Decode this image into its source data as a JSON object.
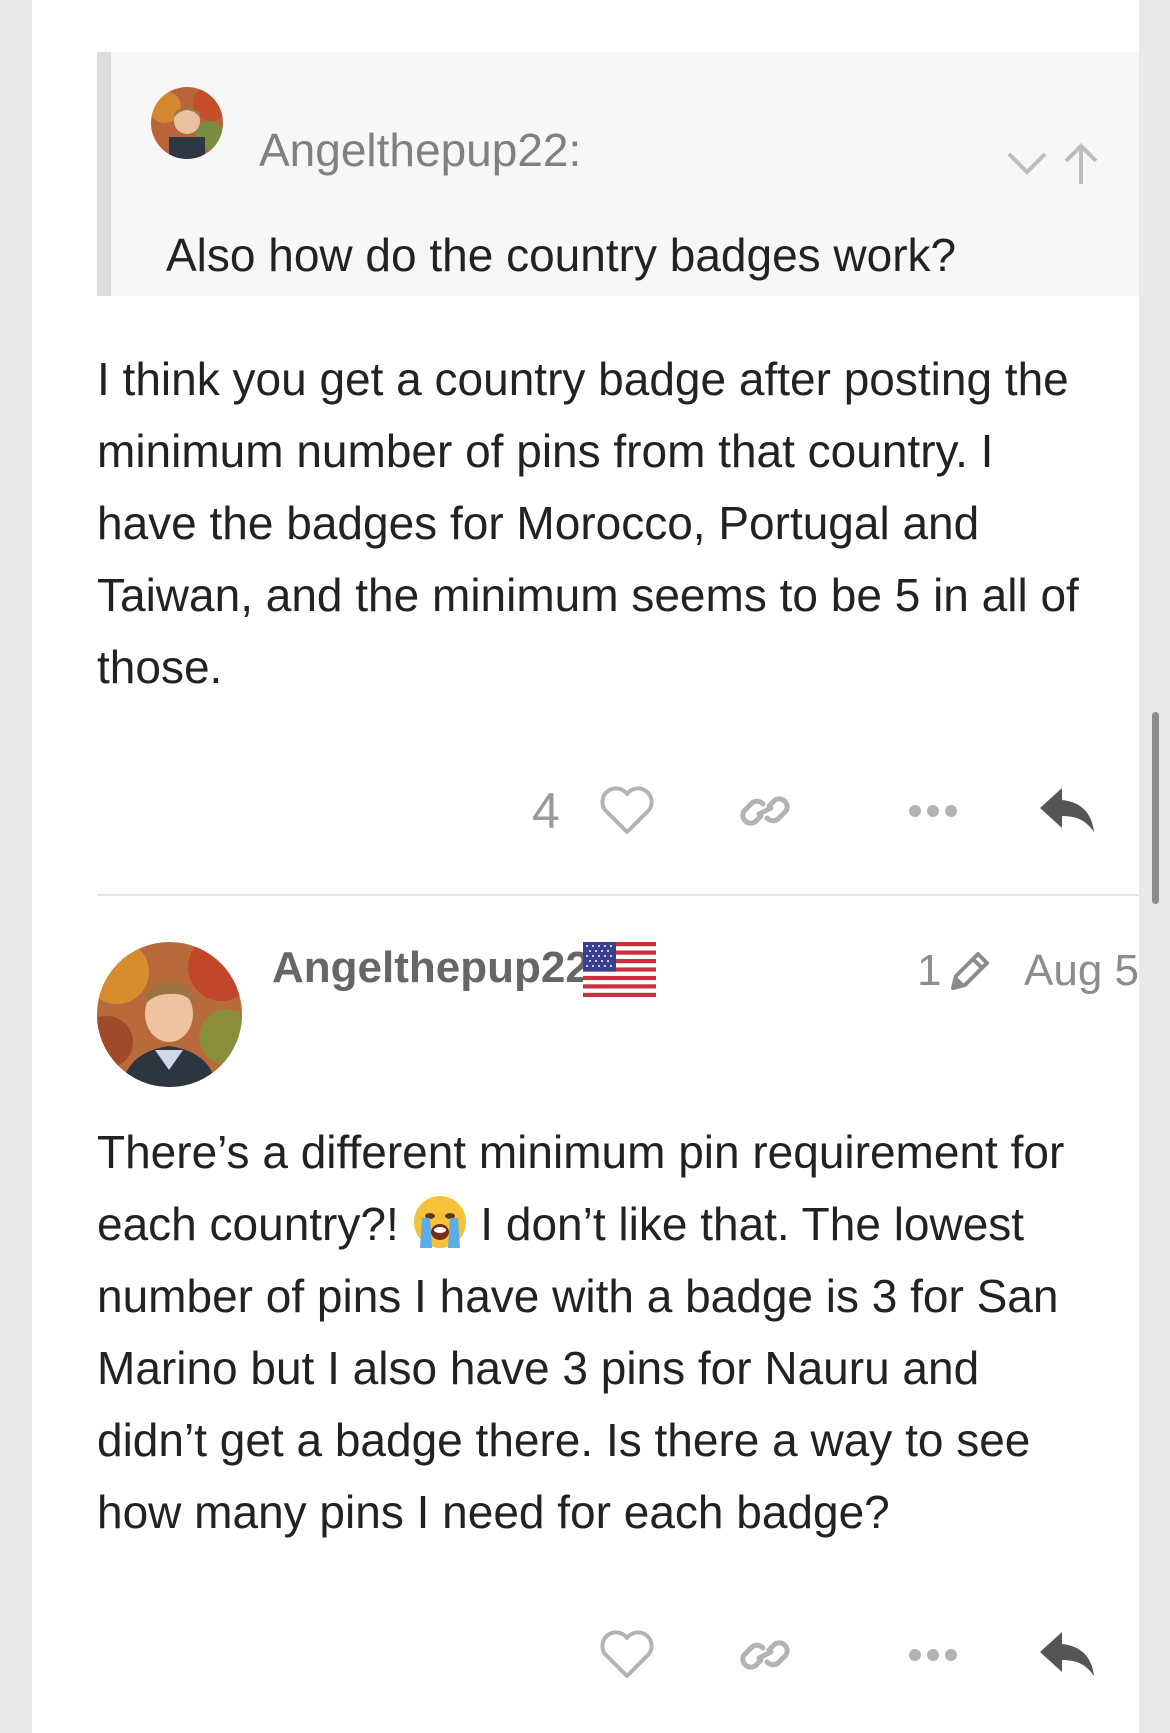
{
  "quote": {
    "author": "Angelthepup22:",
    "text": "Also how do the country badges work?",
    "controls": [
      "chevron-down-icon",
      "arrow-up-icon"
    ]
  },
  "post1": {
    "lines": [
      "I think you get a country badge after posting the",
      "minimum number of pins from that country. I",
      "have the badges for Morocco, Portugal and",
      "Taiwan, and the minimum seems to be 5 in all of",
      "those."
    ],
    "like_count": "4",
    "actions": [
      "heart-icon",
      "link-icon",
      "more-icon",
      "reply-icon"
    ]
  },
  "post2": {
    "username": "Angelthepup22",
    "flag": "us-flag-icon",
    "edit_count": "1",
    "date": "Aug 5",
    "line1": "There’s a different minimum pin requirement for",
    "line2_a": "each country?! ",
    "emoji": "😭",
    "line2_b": " I don’t like that. The lowest",
    "lines_rest": [
      "number of pins I have with a badge is 3 for San",
      "Marino but I also have 3 pins for Nauru and",
      "didn’t get a badge there. Is there a way to see",
      "how many pins I need for each badge?"
    ],
    "actions": [
      "heart-icon",
      "link-icon",
      "more-icon",
      "reply-icon"
    ]
  },
  "colors": {
    "muted_text": "#808080",
    "body_text": "#222222",
    "quote_bg": "#f7f7f7",
    "quote_border": "#dddddd",
    "icon_gray": "#b3b3b3",
    "reply_icon": "#555555"
  }
}
